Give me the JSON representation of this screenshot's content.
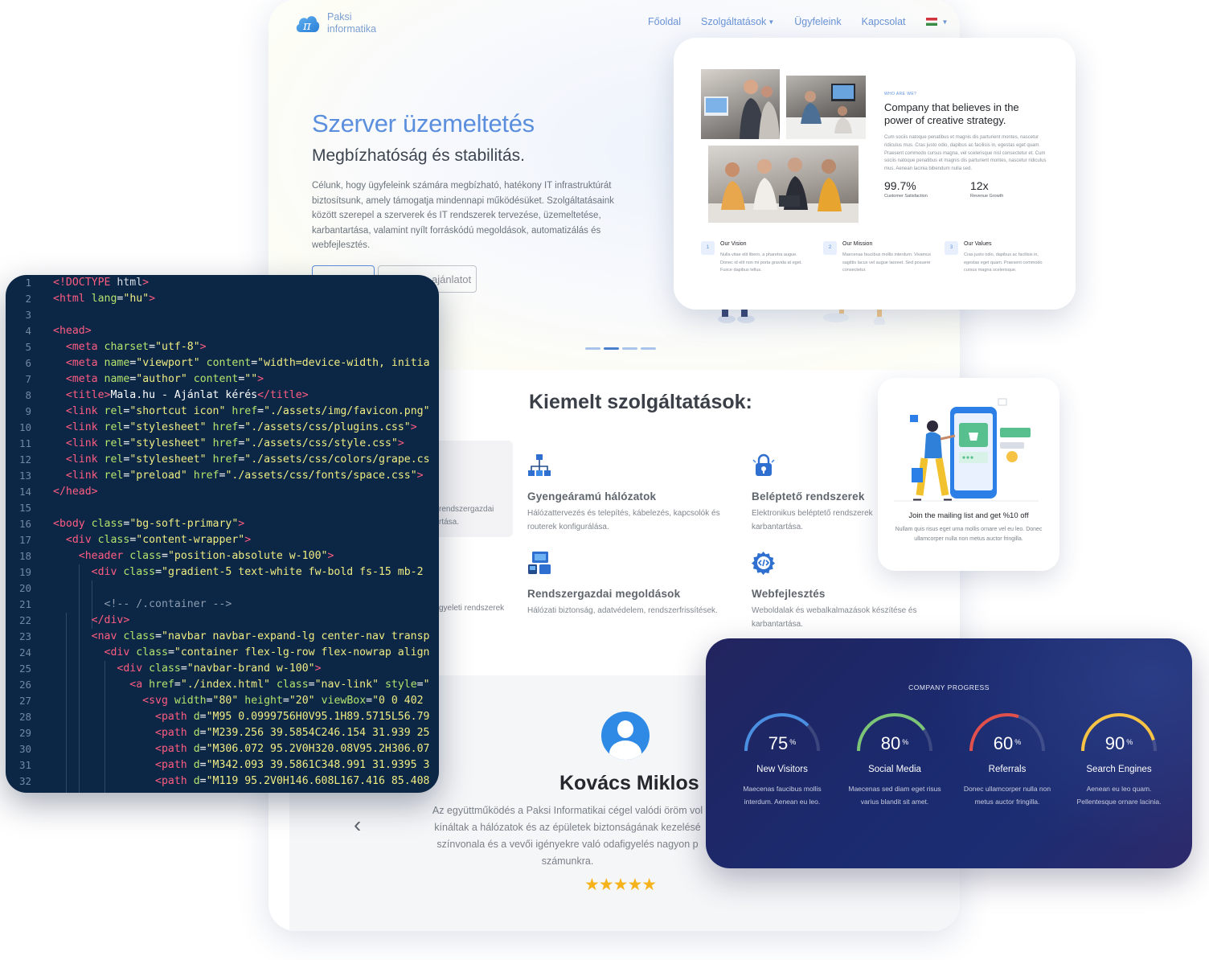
{
  "site": {
    "logo_line1": "Paksi",
    "logo_line2": "informatika",
    "nav": [
      {
        "label": "Főoldal"
      },
      {
        "label": "Szolgáltatások",
        "dropdown": true
      },
      {
        "label": "Ügyfeleink"
      },
      {
        "label": "Kapcsolat"
      }
    ],
    "language_flag": "hungary-flag-icon",
    "hero": {
      "title": "Szerver üzemeltetés",
      "subtitle": "Megbízhatóság és stabilitás.",
      "text": "Célunk, hogy ügyfeleink számára megbízható, hatékony IT infrastruktúrát biztosítsunk, amely támogatja mindennapi működésüket. Szolgáltatásaink között szerepel a szerverek és IT rendszerek tervezése, üzemeltetése, karbantartása, valamint nyílt forráskódú megoldások, automatizálás és webfejlesztés.",
      "secondary_button": "ajánlatot"
    },
    "services_title": "Kiemelt szolgáltatások:",
    "services_fragments": [
      "rendszergazdai",
      "rtása.",
      "gyeleti rendszerek"
    ],
    "services": [
      {
        "icon": "network-icon",
        "title": "Gyengeáramú hálózatok",
        "desc": "Hálózattervezés és telepítés, kábelezés, kapcsolók és routerek konfigurálása."
      },
      {
        "icon": "access-lock-icon",
        "title": "Beléptető rendszerek",
        "desc": "Elektronikus beléptető rendszerek karbantartása."
      },
      {
        "icon": "sysadmin-icon",
        "title": "Rendszergazdai megoldások",
        "desc": "Hálózati biztonság, adatvédelem, rendszerfrissítések."
      },
      {
        "icon": "webdev-gear-icon",
        "title": "Webfejlesztés",
        "desc": "Weboldalak és webalkalmazások készítése és karbantartása."
      }
    ],
    "testimonial": {
      "name": "Kovács Miklos",
      "quote": "Az együttműködés a Paksi Informatikai cégel valódi öröm vol kínáltak a hálózatok és az épületek biztonságának kezelésé színvonala és a vevői igényekre való odafigyelés nagyon p számunkra.",
      "rating": 5,
      "stars": "★★★★★"
    }
  },
  "about": {
    "eyebrow": "WHO ARE WE?",
    "title": "Company that believes in the power of creative strategy.",
    "text": "Cum sociis natoque penatibus et magnis dis parturient montes, nascetur ridiculus mus. Cras justo odio, dapibus ac facilisis in, egestas eget quam. Praesent commodo cursus magna, vel scelerisque nisl consectetur et. Cum sociis natoque penatibus et magnis dis parturient montes, nascetur ridiculus mus. Aenean lacinia bibendum nulla sed.",
    "stats": [
      {
        "value": "99.7%",
        "label": "Customer Satisfaction"
      },
      {
        "value": "12x",
        "label": "Revenue Growth"
      }
    ],
    "items": [
      {
        "num": "1",
        "title": "Our Vision",
        "text": "Nulla vitae elit libero, a pharetra augue. Donec id elit non mi porta gravida at eget. Fusce dapibus tellus."
      },
      {
        "num": "2",
        "title": "Our Mission",
        "text": "Maecenas faucibus mollis interdum. Vivamus sagittis lacus vel augue laoreet. Sed posuere consectetur."
      },
      {
        "num": "3",
        "title": "Our Values",
        "text": "Cras justo odio, dapibus ac facilisis in, egestas eget quam. Praesent commodo cursus magna scelerisque."
      }
    ]
  },
  "mailing": {
    "title": "Join the mailing list and get %10 off",
    "text": "Nullam quis risus eget urna mollis ornare vel eu leo. Donec ullamcorper nulla non metus auctor fringilla."
  },
  "code": {
    "lines": [
      "<!DOCTYPE html>",
      "<html lang=\"hu\">",
      "",
      "<head>",
      "  <meta charset=\"utf-8\">",
      "  <meta name=\"viewport\" content=\"width=device-width, initia",
      "  <meta name=\"author\" content=\"\">",
      "  <title>Mala.hu - Ajánlat kérés</title>",
      "  <link rel=\"shortcut icon\" href=\"./assets/img/favicon.png\"",
      "  <link rel=\"stylesheet\" href=\"./assets/css/plugins.css\">",
      "  <link rel=\"stylesheet\" href=\"./assets/css/style.css\">",
      "  <link rel=\"stylesheet\" href=\"./assets/css/colors/grape.cs",
      "  <link rel=\"preload\" href=\"./assets/css/fonts/space.css\">",
      "</head>",
      "",
      "<body class=\"bg-soft-primary\">",
      "  <div class=\"content-wrapper\">",
      "    <header class=\"position-absolute w-100\">",
      "      <div class=\"gradient-5 text-white fw-bold fs-15 mb-2",
      "",
      "        <!-- /.container -->",
      "      </div>",
      "      <nav class=\"navbar navbar-expand-lg center-nav transp",
      "        <div class=\"container flex-lg-row flex-nowrap align",
      "          <div class=\"navbar-brand w-100\">",
      "            <a href=\"./index.html\" class=\"nav-link\" style=\"",
      "              <svg width=\"80\" height=\"20\" viewBox=\"0 0 402",
      "                <path d=\"M95 0.0999756H0V95.1H89.5715L56.79",
      "                <path d=\"M239.256 39.5854C246.154 31.939 25",
      "                <path d=\"M306.072 95.2V0H320.08V95.2H306.07",
      "                <path d=\"M342.093 39.5861C348.991 31.9395 3",
      "                <path d=\"M119 95.2V0H146.608L167.416 85.408"
    ]
  },
  "progress": {
    "title": "COMPANY PROGRESS",
    "items": [
      {
        "value": 75,
        "unit": "%",
        "label": "New Visitors",
        "desc": "Maecenas faucibus mollis interdum. Aenean eu leo.",
        "color": "#4a90e2"
      },
      {
        "value": 80,
        "unit": "%",
        "label": "Social Media",
        "desc": "Maecenas sed diam eget risus varius blandit sit amet.",
        "color": "#7cc576"
      },
      {
        "value": 60,
        "unit": "%",
        "label": "Referrals",
        "desc": "Donec ullamcorper nulla non metus auctor fringilla.",
        "color": "#e2504c"
      },
      {
        "value": 90,
        "unit": "%",
        "label": "Search Engines",
        "desc": "Aenean eu leo quam. Pellentesque ornare lacinia.",
        "color": "#f6c344"
      }
    ]
  },
  "colors": {
    "accent": "#5b8fdd",
    "code_bg": "#0b2745",
    "progress_bg": "#1b2a6e",
    "star": "#f5b21b"
  }
}
